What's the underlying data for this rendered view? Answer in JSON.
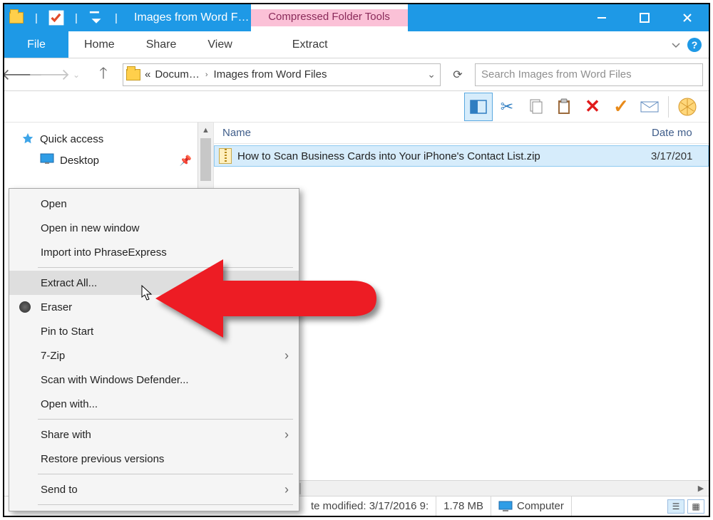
{
  "titlebar": {
    "title": "Images from Word F…",
    "tools_label": "Compressed Folder Tools"
  },
  "ribbon": {
    "file": "File",
    "home": "Home",
    "share": "Share",
    "view": "View",
    "extract": "Extract"
  },
  "address": {
    "seg1": "Docum…",
    "seg2": "Images from Word Files",
    "search_placeholder": "Search Images from Word Files"
  },
  "nav": {
    "quick_access": "Quick access",
    "desktop": "Desktop"
  },
  "columns": {
    "name": "Name",
    "date": "Date mo"
  },
  "files": [
    {
      "name": "How to Scan Business Cards into Your iPhone's Contact List.zip",
      "date": "3/17/201"
    }
  ],
  "context_menu": {
    "open": "Open",
    "open_new": "Open in new window",
    "import_pe": "Import into PhraseExpress",
    "extract_all": "Extract All...",
    "eraser": "Eraser",
    "pin_start": "Pin to Start",
    "seven_zip": "7-Zip",
    "scan_def": "Scan with Windows Defender...",
    "open_with": "Open with...",
    "share_with": "Share with",
    "restore": "Restore previous versions",
    "send_to": "Send to"
  },
  "status": {
    "modified": "te modified: 3/17/2016 9:",
    "size": "1.78 MB",
    "computer": "Computer"
  }
}
